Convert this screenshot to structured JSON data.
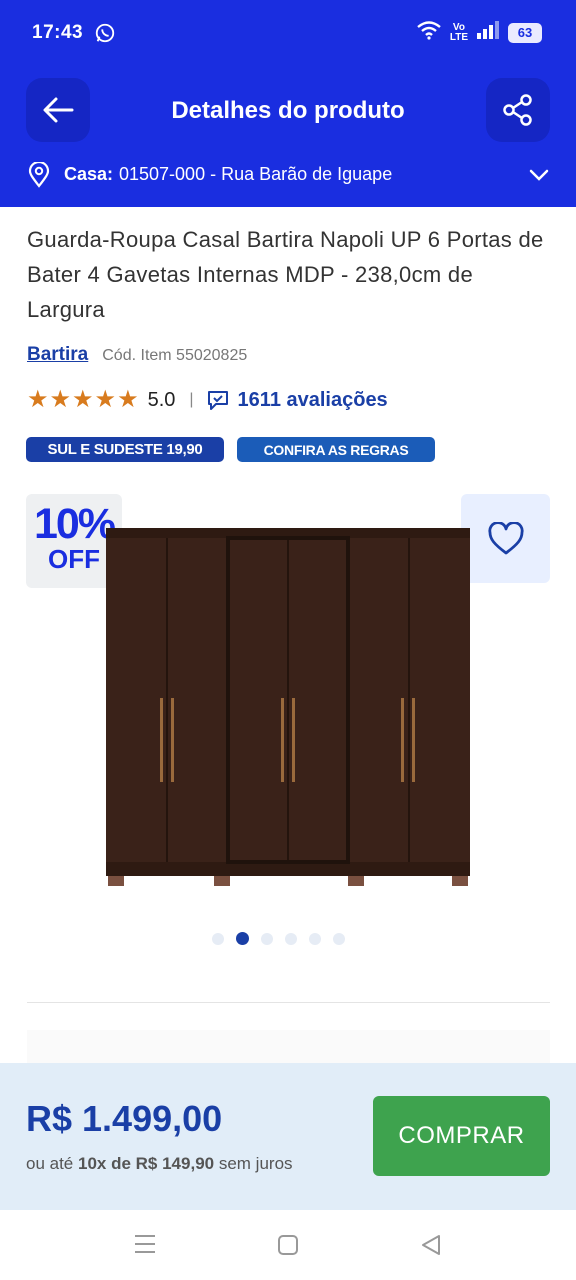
{
  "status_bar": {
    "time": "17:43",
    "network_label_top": "Vo",
    "network_label_bottom": "LTE",
    "battery": "63"
  },
  "header": {
    "title": "Detalhes do produto",
    "back_icon": "arrow-left-icon",
    "share_icon": "share-icon"
  },
  "address": {
    "label": "Casa:",
    "value": "01507-000 - Rua Barão de Iguape"
  },
  "product": {
    "title": "Guarda-Roupa Casal Bartira Napoli UP 6 Portas de Bater 4 Gavetas Internas MDP - 238,0cm de Largura",
    "brand": "Bartira",
    "sku": "Cód. Item 55020825",
    "stars": "★★★★★",
    "rating": "5.0",
    "separator": "|",
    "reviews": "1611 avaliações",
    "tag_shipping": "SUL E SUDESTE 19,90",
    "tag_rules": "CONFIRA AS REGRAS"
  },
  "image": {
    "discount_big": "10%",
    "discount_small": "OFF",
    "slide_count": 6,
    "active_slide": 2
  },
  "buy": {
    "price": "R$ 1.499,00",
    "installment_prefix": "ou até",
    "installment_value": "10x de R$ 149,90",
    "installment_suffix": "sem juros",
    "button": "COMPRAR"
  },
  "colors": {
    "primary_blue": "#1a2ee0",
    "brand_blue": "#1a3fa6",
    "buy_green": "#3ea34e",
    "star_orange": "#d87b1e",
    "wardrobe_brown": "#3a2219"
  }
}
